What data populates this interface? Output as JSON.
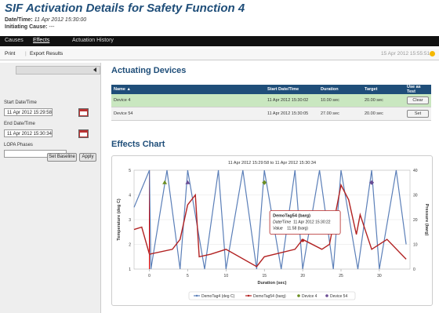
{
  "page": {
    "title": "SIF Activation Details for Safety Function 4",
    "datetime_label": "Date/Time:",
    "datetime_value": "11 Apr 2012 15:30:00",
    "cause_label": "Initiating Cause:",
    "cause_value": "---"
  },
  "nav": {
    "tabs": [
      "Causes",
      "Effects",
      "Actuation History"
    ],
    "active": "Effects"
  },
  "toolbar": {
    "print": "Print",
    "export": "Export Results",
    "timestamp": "15 Apr 2012 15:55:51"
  },
  "sidebar": {
    "start_label": "Start Date/Time",
    "start_value": "11 Apr 2012 15:29:58",
    "end_label": "End Date/Time",
    "end_value": "11 Apr 2012 15:30:34",
    "lopa_label": "LOPA Phases",
    "baseline_btn": "Set Baseline",
    "apply_btn": "Apply"
  },
  "devices": {
    "heading": "Actuating Devices",
    "columns": [
      "Name ▲",
      "Start Date/Time",
      "Duration",
      "Target",
      "Use as Test"
    ],
    "rows": [
      {
        "name": "Device 4",
        "start": "11 Apr 2012 15:30:02",
        "duration": "10.00 sec",
        "target": "20.00 sec",
        "action": "Clear"
      },
      {
        "name": "Device 54",
        "start": "11 Apr 2012 15:30:05",
        "duration": "27.00 sec",
        "target": "20.00 sec",
        "action": "Set"
      }
    ]
  },
  "effects": {
    "heading": "Effects Chart"
  },
  "chart_data": {
    "type": "line",
    "title": "11 Apr 2012 15:29:58 to 11 Apr 2012 15:30:34",
    "xlabel": "Duration (sec)",
    "ylabel_left": "Temperature (deg C)",
    "ylabel_right": "Pressure (barg)",
    "xlim": [
      -2,
      34
    ],
    "ylim_left": [
      1,
      5
    ],
    "ylim_right": [
      0,
      40
    ],
    "x_ticks": [
      0,
      5,
      10,
      15,
      20,
      25,
      30
    ],
    "y_left_ticks": [
      1,
      2,
      3,
      4,
      5
    ],
    "y_right_ticks": [
      0,
      10,
      20,
      30,
      40
    ],
    "series": [
      {
        "name": "DemoTag4 (deg C)",
        "axis": "left",
        "color": "#5b7fb8",
        "x": [
          -2,
          0,
          0.2,
          2.3,
          4,
          5,
          7.2,
          9,
          10,
          12.2,
          14,
          15,
          17.2,
          19,
          20,
          22.2,
          24,
          25,
          27.2,
          29,
          30,
          32.2,
          33.5
        ],
        "y": [
          3.5,
          5,
          1,
          5,
          1,
          5,
          1,
          5,
          1,
          5,
          1,
          5,
          1,
          5,
          1,
          5,
          1,
          5,
          1,
          5,
          1,
          5,
          2
        ]
      },
      {
        "name": "DemoTag54 (barg)",
        "axis": "right",
        "color": "#b22222",
        "x": [
          -2,
          -1,
          0,
          3,
          4,
          5,
          6,
          6.5,
          8,
          10,
          14,
          15,
          19,
          20,
          22.5,
          23.5,
          25,
          26,
          27,
          27.5,
          29,
          31,
          33.5
        ],
        "y": [
          16,
          17,
          6,
          8,
          12,
          26,
          30,
          5,
          6,
          8,
          1,
          5,
          8,
          12,
          8,
          10,
          34,
          28,
          14,
          22,
          8,
          12,
          4
        ]
      }
    ],
    "markers": [
      {
        "name": "Device 4",
        "x": 2,
        "y": 4.5,
        "color": "#6b8e23",
        "shape": "triangle"
      },
      {
        "name": "Device 4",
        "x": 15,
        "y": 4.5,
        "color": "#6b8e23",
        "shape": "diamond"
      },
      {
        "name": "Device 54",
        "x": 5,
        "y": 4.5,
        "color": "#6a4c93",
        "shape": "triangle"
      },
      {
        "name": "Device 54",
        "x": 29,
        "y": 4.5,
        "color": "#6a4c93",
        "shape": "diamond"
      }
    ],
    "cursor_x": 0,
    "tooltip": {
      "title": "DemoTag54 (barg)",
      "time_label": "Date/Time",
      "time": "11 Apr 2012 15:30:22",
      "value_label": "Value",
      "value": "11.58 (barg)",
      "x": 20,
      "y_right": 11.58
    },
    "legend": {
      "position": "bottom",
      "items": [
        {
          "label": "DemoTag4 (deg C)",
          "color": "#5b7fb8",
          "shape": "line"
        },
        {
          "label": "DemoTag54 (barg)",
          "color": "#b22222",
          "shape": "line"
        },
        {
          "label": "Device 4",
          "color": "#6b8e23",
          "shape": "dot"
        },
        {
          "label": "Device 54",
          "color": "#6a4c93",
          "shape": "dot"
        }
      ]
    }
  }
}
